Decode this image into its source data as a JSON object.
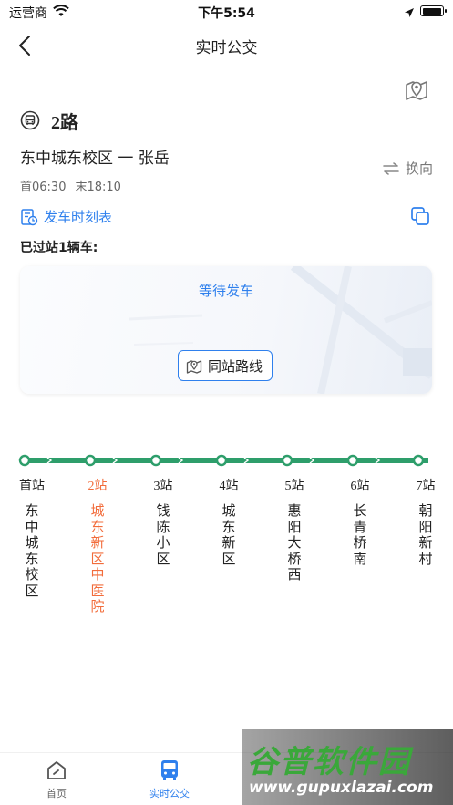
{
  "status_bar": {
    "carrier": "运营商",
    "time": "下午5:54"
  },
  "nav": {
    "title": "实时公交"
  },
  "route": {
    "name": "2路",
    "direction": "东中城东校区 一 张岳",
    "first_bus": "首06:30",
    "last_bus": "末18:10"
  },
  "actions": {
    "switch_direction": "换向",
    "schedule": "发车时刻表"
  },
  "passed_label": "已过站1辆车:",
  "wait_card": {
    "status": "等待发车",
    "same_stop_button": "同站路线"
  },
  "stops": [
    {
      "num": "首站",
      "name": "东中城东校区"
    },
    {
      "num": "2站",
      "name": "城东新区中医院",
      "current": true
    },
    {
      "num": "3站",
      "name": "钱陈小区"
    },
    {
      "num": "4站",
      "name": "城东新区"
    },
    {
      "num": "5站",
      "name": "惠阳大桥西"
    },
    {
      "num": "6站",
      "name": "长青桥南"
    },
    {
      "num": "7站",
      "name": "朝阳新村"
    }
  ],
  "tabbar": {
    "items": [
      {
        "label": "首页",
        "icon": "home-icon"
      },
      {
        "label": "实时公交",
        "icon": "bus-icon",
        "active": true
      }
    ]
  },
  "watermark": {
    "title": "谷普软件园",
    "url": "www.gupuxlazai.com"
  },
  "colors": {
    "accent": "#2f80ed",
    "line_green": "#2e9e6b",
    "current_stop": "#f26c3b"
  }
}
